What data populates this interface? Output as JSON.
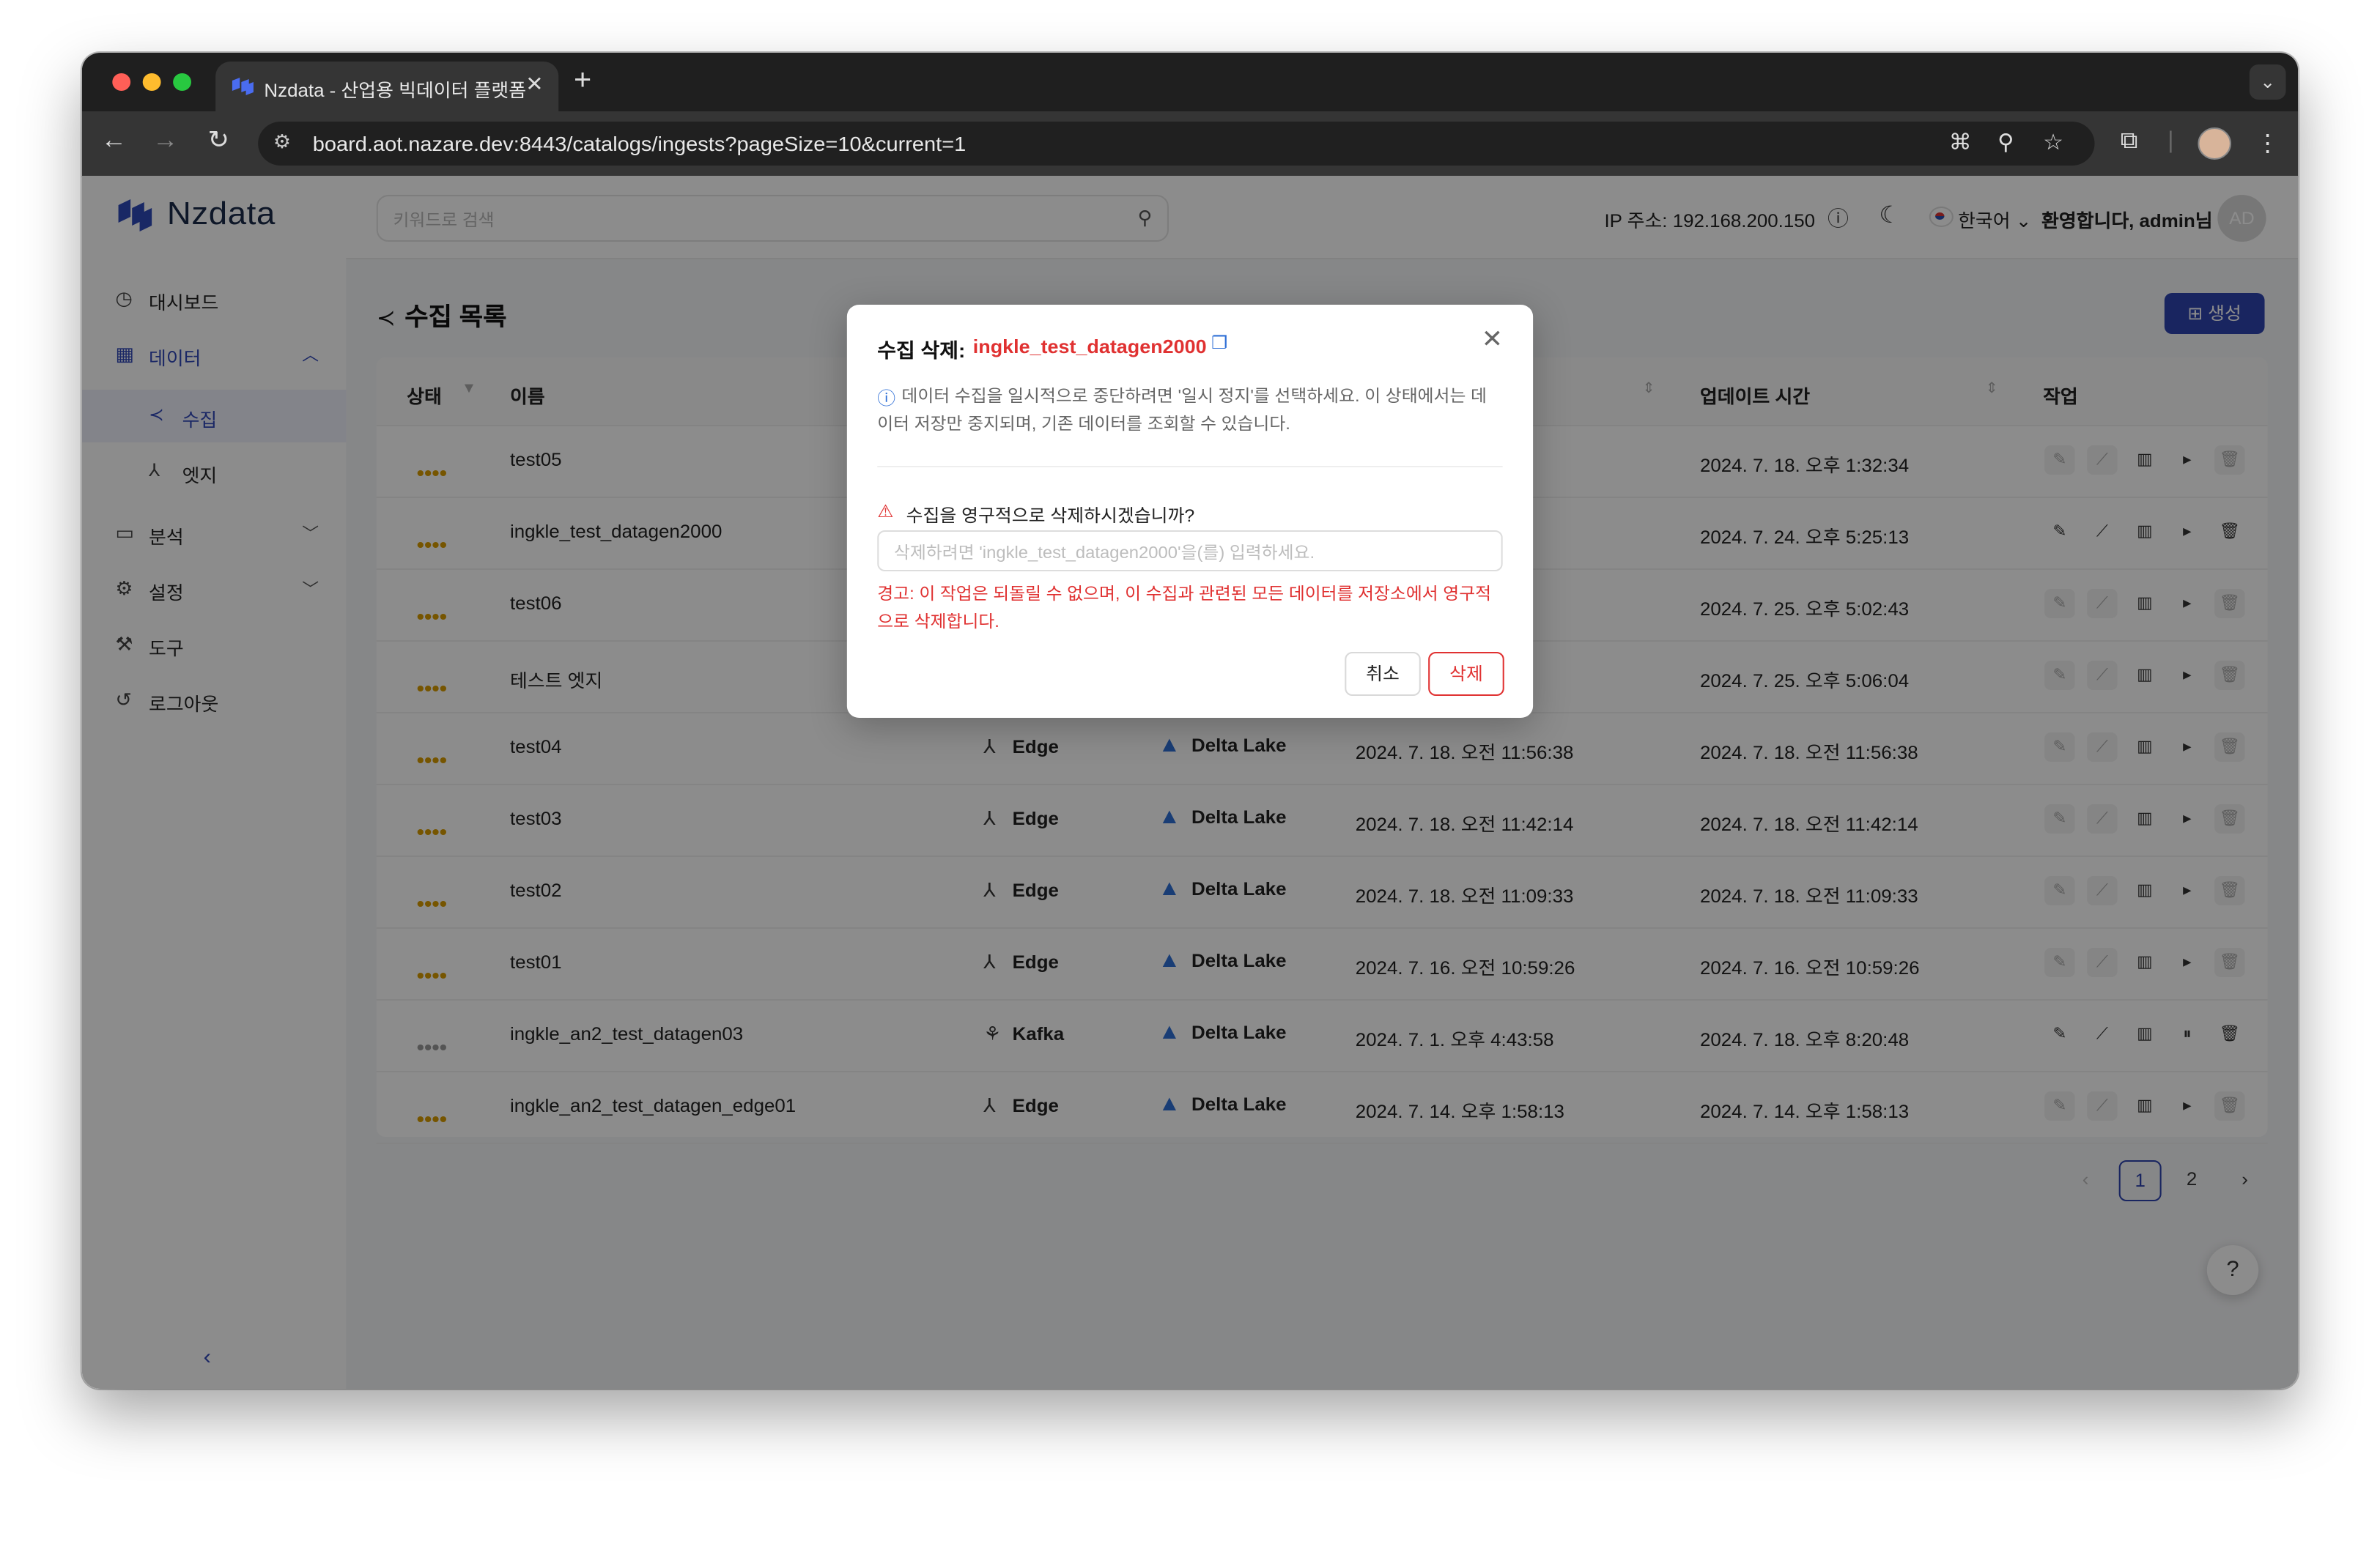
{
  "browser": {
    "tab_title": "Nzdata - 산업용 빅데이터 플랫폼",
    "url": "board.aot.nazare.dev:8443/catalogs/ingests?pageSize=10&current=1",
    "lights": [
      "#ff5f57",
      "#febc2e",
      "#28c840"
    ]
  },
  "app": {
    "logo": "Nzdata",
    "search_placeholder": "키워드로 검색",
    "ip": "IP 주소: 192.168.200.150",
    "language": "한국어",
    "welcome": "환영합니다, admin님",
    "avatar": "AD",
    "accent": "#2f44b0"
  },
  "sidebar": {
    "items": [
      {
        "label": "대시보드",
        "icon": "dashboard-icon"
      },
      {
        "label": "데이터",
        "icon": "data-grid-icon"
      },
      {
        "label": "분석",
        "icon": "monitor-icon"
      },
      {
        "label": "설정",
        "icon": "gear-icon"
      },
      {
        "label": "도구",
        "icon": "wrench-icon"
      },
      {
        "label": "로그아웃",
        "icon": "logout-icon"
      }
    ],
    "sub_items": [
      {
        "label": "수집",
        "icon": "share-icon"
      },
      {
        "label": "엣지",
        "icon": "edge-icon"
      }
    ]
  },
  "page": {
    "title": "수집 목록",
    "create_label": "생성",
    "columns": [
      "상태",
      "이름",
      "업데이트 시간",
      "작업"
    ],
    "rows": [
      {
        "name": "test05",
        "source": "",
        "dest": "",
        "created": ":34",
        "updated": "2024. 7. 18. 오후 1:32:34",
        "status": "running"
      },
      {
        "name": "ingkle_test_datagen2000",
        "source": "",
        "dest": "",
        "created": "5:13",
        "updated": "2024. 7. 24. 오후 5:25:13",
        "status": "running"
      },
      {
        "name": "test06",
        "source": "",
        "dest": "",
        "created": "2:43",
        "updated": "2024. 7. 25. 오후 5:02:43",
        "status": "running"
      },
      {
        "name": "테스트 엣지",
        "source": "",
        "dest": "",
        "created": "6:04",
        "updated": "2024. 7. 25. 오후 5:06:04",
        "status": "running"
      },
      {
        "name": "test04",
        "source": "Edge",
        "dest": "Delta Lake",
        "created": "2024. 7. 18. 오전 11:56:38",
        "updated": "2024. 7. 18. 오전 11:56:38",
        "status": "running"
      },
      {
        "name": "test03",
        "source": "Edge",
        "dest": "Delta Lake",
        "created": "2024. 7. 18. 오전 11:42:14",
        "updated": "2024. 7. 18. 오전 11:42:14",
        "status": "running"
      },
      {
        "name": "test02",
        "source": "Edge",
        "dest": "Delta Lake",
        "created": "2024. 7. 18. 오전 11:09:33",
        "updated": "2024. 7. 18. 오전 11:09:33",
        "status": "running"
      },
      {
        "name": "test01",
        "source": "Edge",
        "dest": "Delta Lake",
        "created": "2024. 7. 16. 오전 10:59:26",
        "updated": "2024. 7. 16. 오전 10:59:26",
        "status": "running"
      },
      {
        "name": "ingkle_an2_test_datagen03",
        "source": "Kafka",
        "dest": "Delta Lake",
        "created": "2024. 7. 1. 오후 4:43:58",
        "updated": "2024. 7. 18. 오후 8:20:48",
        "status": "paused"
      },
      {
        "name": "ingkle_an2_test_datagen_edge01",
        "source": "Edge",
        "dest": "Delta Lake",
        "created": "2024. 7. 14. 오후 1:58:13",
        "updated": "2024. 7. 14. 오후 1:58:13",
        "status": "running"
      }
    ],
    "pagination": {
      "prev": "‹",
      "pages": [
        "1",
        "2"
      ],
      "next": "›",
      "current": "1"
    }
  },
  "modal": {
    "title": "수집 삭제:",
    "name": "ingkle_test_datagen2000",
    "info": "데이터 수집을 일시적으로 중단하려면 '일시 정지'를 선택하세요. 이 상태에서는 데이터 저장만 중지되며, 기존 데이터를 조회할 수 있습니다.",
    "question": "수집을 영구적으로 삭제하시겠습니까?",
    "input_placeholder": "삭제하려면 'ingkle_test_datagen2000'을(를) 입력하세요.",
    "warning": "경고: 이 작업은 되돌릴 수 없으며, 이 수집과 관련된 모든 데이터를 저장소에서 영구적으로 삭제합니다.",
    "cancel_label": "취소",
    "delete_label": "삭제"
  }
}
